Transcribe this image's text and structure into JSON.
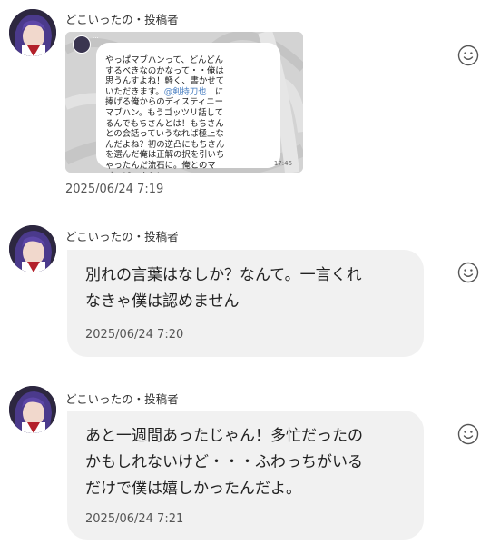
{
  "posts": [
    {
      "author": "どこいったの・投稿者",
      "image": {
        "text_lead": "やっぱマブハンって、どんどん\nするべきなのかなって・・俺は\n思うんすよね！軽く、書かせて\nいただきます。",
        "mention": "@剣持刀也",
        "text_after_mention": "　に\n捧げる俺からのディスティニー\nマブハン。もうゴッツリ話して\nるんでもちさんとは！もちさん\nとの会話っていうなれば極上な\nんだよね？初の逆凸にもちさん\nを選んだ俺は正解の択を引いち\nゃったんだ流石に。俺とのマ\nブ、どっすか！",
        "header_dots": "...",
        "screenshot_time": "17:46"
      },
      "time": "2025/06/24 7:19"
    },
    {
      "author": "どこいったの・投稿者",
      "text": "別れの言葉はなしか？なんて。一言くれ\nなきゃ僕は認めません",
      "time": "2025/06/24 7:20"
    },
    {
      "author": "どこいったの・投稿者",
      "text": "あと一週間あったじゃん！多忙だったの\nかもしれないけど・・・ふわっちがいる\nだけで僕は嬉しかったんだよ。",
      "time": "2025/06/24 7:21"
    }
  ],
  "icons": {
    "avatar": "avatar-icon",
    "reaction": "smiley-icon"
  },
  "colors": {
    "bubble": "#f1f1f1",
    "mention": "#4a7fc1",
    "timestamp": "#555555"
  }
}
